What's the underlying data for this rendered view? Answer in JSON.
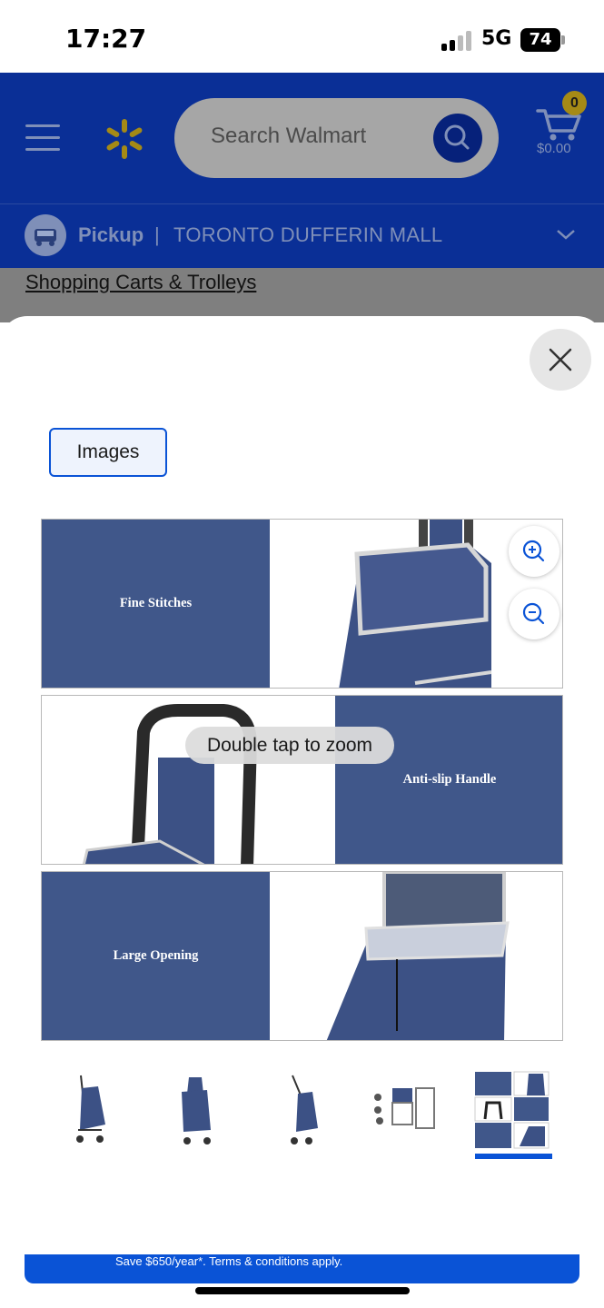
{
  "status_bar": {
    "time": "17:27",
    "network": "5G",
    "battery": "74"
  },
  "header": {
    "search_placeholder": "Search Walmart",
    "cart_count": "0",
    "cart_total": "$0.00",
    "icons": [
      "menu-icon",
      "walmart-spark-icon",
      "search-icon",
      "cart-icon"
    ]
  },
  "pickup": {
    "label": "Pickup",
    "separator": "|",
    "store": "TORONTO DUFFERIN MALL"
  },
  "breadcrumb": "Shopping Carts & Trolleys",
  "modal": {
    "tab_label": "Images",
    "zoom_tip": "Double tap to zoom",
    "features": [
      {
        "label": "Fine Stitches"
      },
      {
        "label": "Anti-slip Handle"
      },
      {
        "label": "Large Opening"
      }
    ],
    "thumbnails": 5,
    "selected_thumbnail": 5
  },
  "promo": {
    "text": "Save $650/year*. Terms & conditions apply."
  },
  "colors": {
    "walmart_blue": "#0a2f96",
    "product_blue": "#40578a",
    "accent": "#0a53d6",
    "spark_yellow": "#ffc220"
  }
}
